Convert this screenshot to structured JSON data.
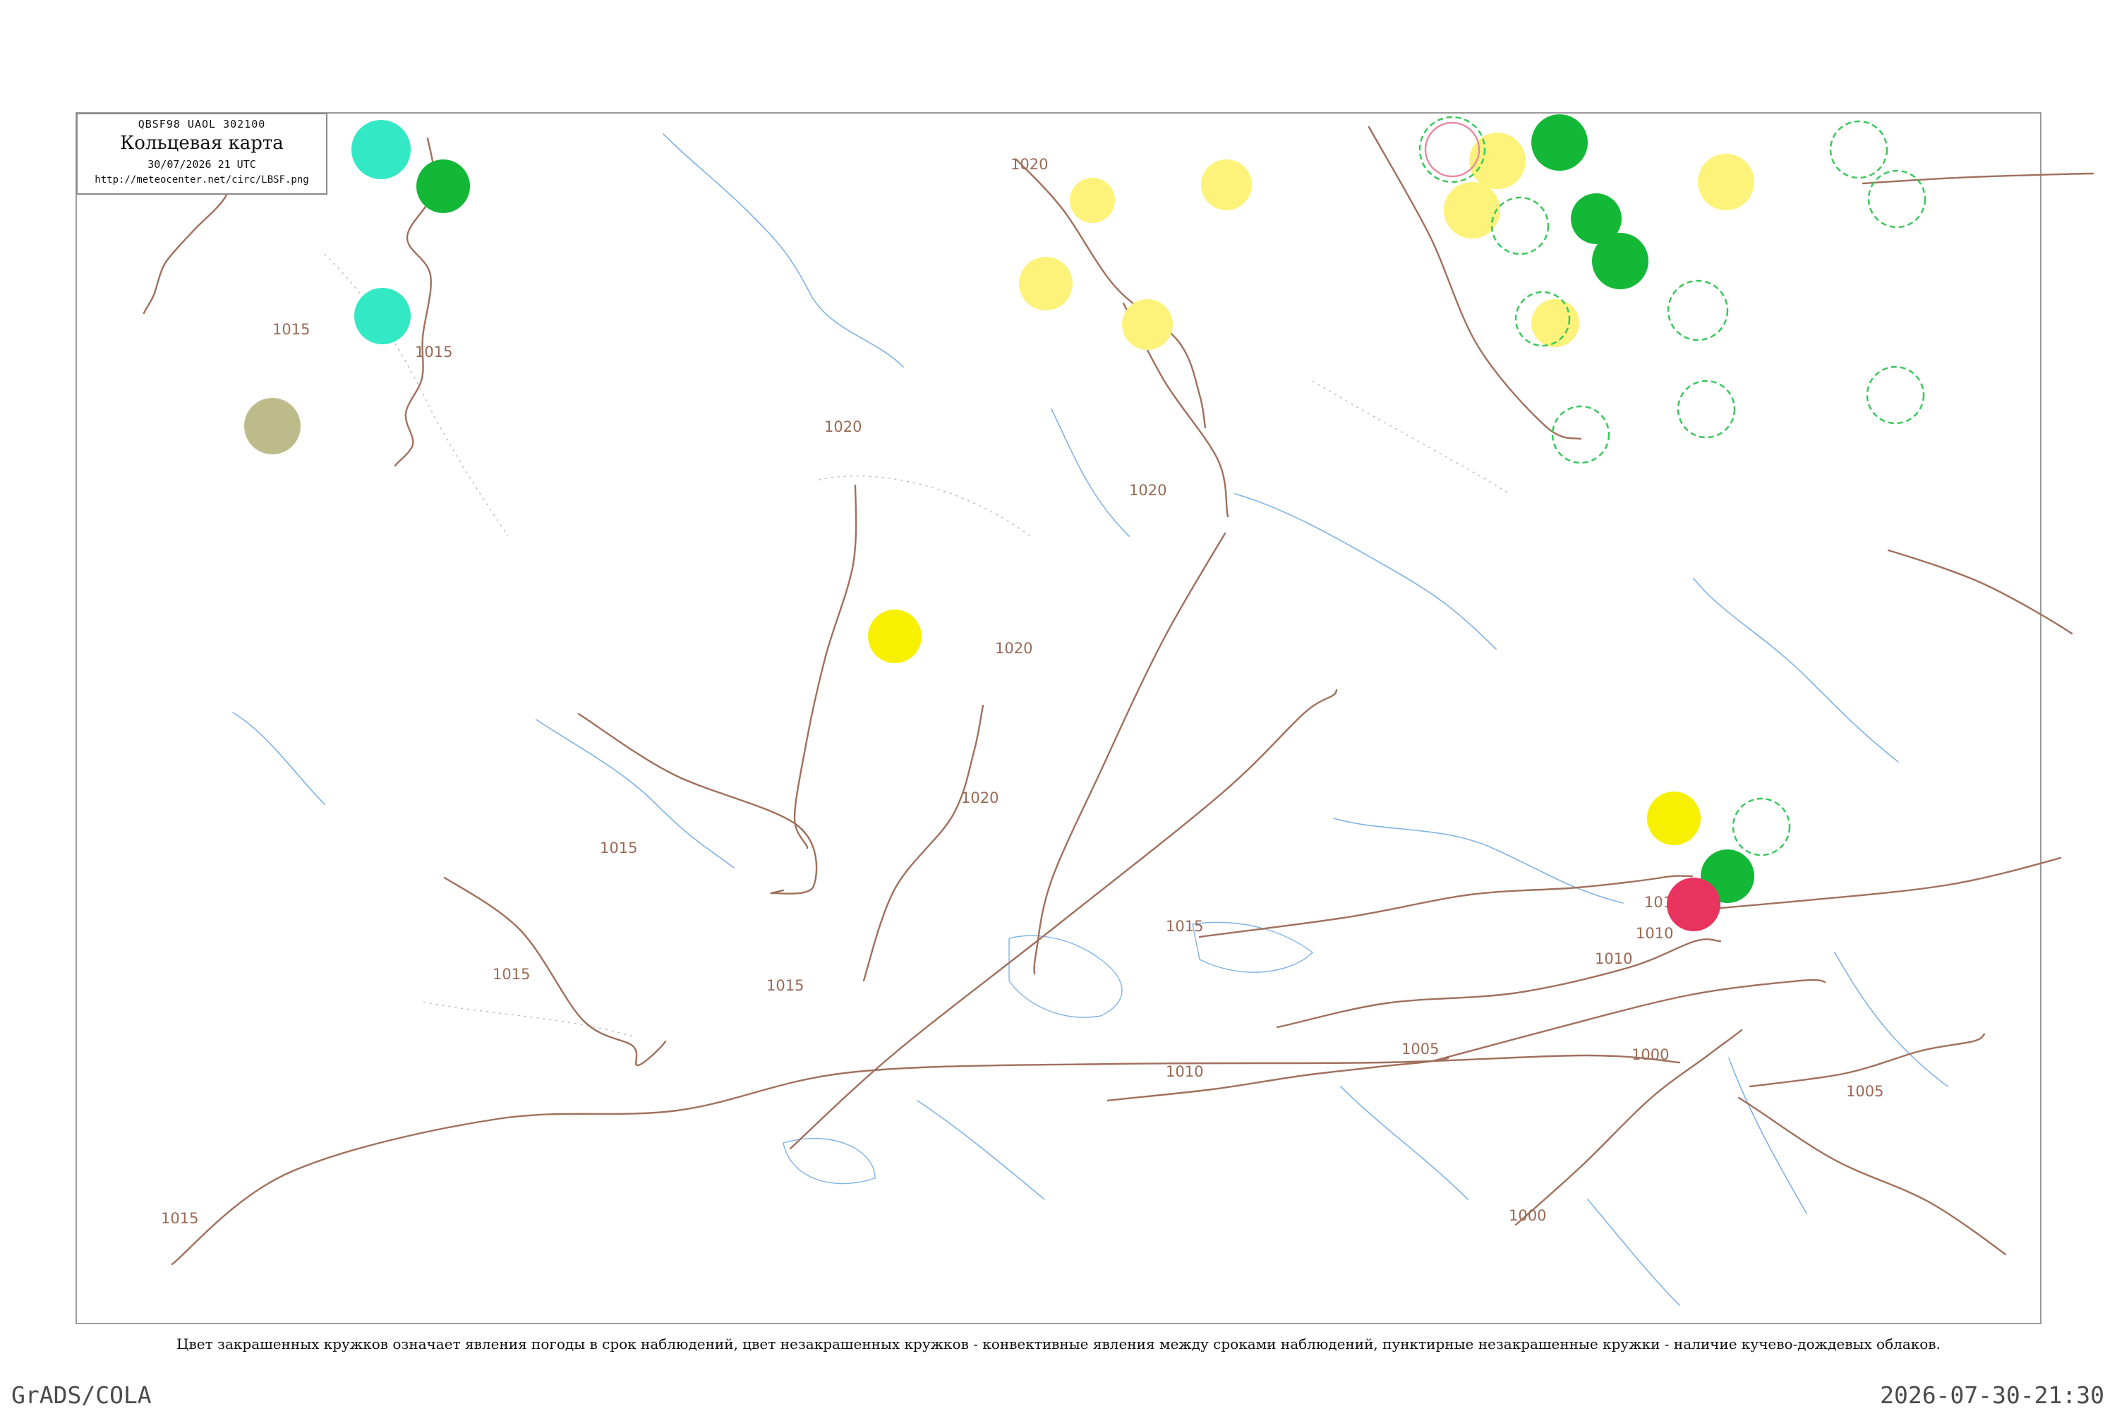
{
  "header": {
    "code": "QBSF98  UAOL  302100",
    "title": "Кольцевая карта",
    "date": "30/07/2026 21 UTC",
    "url": "http://meteocenter.net/circ/LBSF.png"
  },
  "isobars": [
    {
      "label": "1015"
    },
    {
      "label": "1015"
    },
    {
      "label": "1015"
    },
    {
      "label": "1015"
    },
    {
      "label": "1015"
    },
    {
      "label": "1015"
    },
    {
      "label": "1020"
    },
    {
      "label": "1020"
    },
    {
      "label": "1020"
    },
    {
      "label": "1020"
    },
    {
      "label": "1020"
    },
    {
      "label": "1015"
    },
    {
      "label": "1010"
    },
    {
      "label": "1010"
    },
    {
      "label": "1010"
    },
    {
      "label": "1005"
    },
    {
      "label": "1005"
    },
    {
      "label": "1000"
    },
    {
      "label": "1000"
    },
    {
      "label": "1010"
    }
  ],
  "legend": {
    "text": "Цвет закрашенных кружков означает явления погоды в срок наблюдений, цвет незакрашенных кружков - конвективные явления между сроками наблюдений, пунктирные незакрашенные кружки - наличие кучево-дождевых облаков."
  },
  "footer": {
    "left": "GrADS/COLA",
    "right": "2026-07-30-21:30"
  },
  "colors": {
    "isobar": "#a0705c",
    "river": "#7fb2e5",
    "yellow": "#fdf27a",
    "bright_yellow": "#f7f000",
    "green": "#13b837",
    "light_green": "#3ac75a",
    "cyan": "#33e8c5",
    "olive": "#bdbb8a",
    "red": "#e8335f"
  }
}
